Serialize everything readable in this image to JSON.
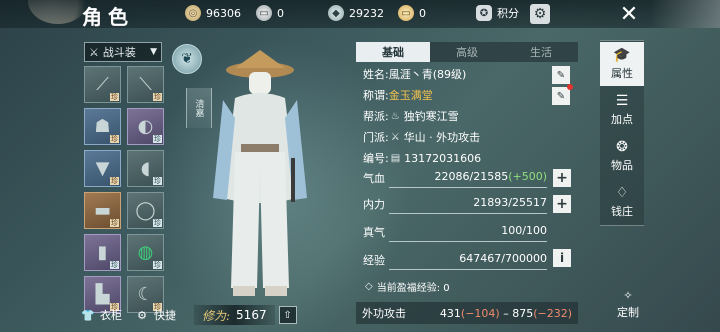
{
  "header": {
    "title": "角色",
    "currencies": [
      {
        "icon": "coin-icon",
        "value": "96306"
      },
      {
        "icon": "silver-ticket-icon",
        "value": "0"
      },
      {
        "icon": "ingot-icon",
        "value": "29232"
      },
      {
        "icon": "gold-ticket-icon",
        "value": "0"
      }
    ],
    "score_label": "积分",
    "colors": {
      "accent_gold": "#f2c14e",
      "bonus_green": "#8fe07d",
      "penalty_red": "#f08a6d"
    }
  },
  "equipment": {
    "set_name": "战斗装",
    "slots": [
      {
        "icon": "flute-icon",
        "tag": "珍"
      },
      {
        "icon": "staff-icon",
        "tag": "珍"
      },
      {
        "icon": "helmet-icon",
        "tag": "珍"
      },
      {
        "icon": "bracer-icon",
        "tag": "珍"
      },
      {
        "icon": "chest-armor-icon",
        "tag": "珍"
      },
      {
        "icon": "arm-guard-icon",
        "tag": "珍"
      },
      {
        "icon": "belt-icon",
        "tag": "珍"
      },
      {
        "icon": "ring-icon",
        "tag": "珍"
      },
      {
        "icon": "leg-guard-icon",
        "tag": "珍"
      },
      {
        "icon": "jade-bracelet-icon",
        "tag": "珍"
      },
      {
        "icon": "boots-icon",
        "tag": "珍"
      },
      {
        "icon": "hook-icon",
        "tag": "珍"
      }
    ],
    "style_badge": "清嘉"
  },
  "bottom": {
    "wardrobe_label": "衣柜",
    "shortcut_label": "快捷",
    "cultivation_label": "修为:",
    "cultivation_value": "5167"
  },
  "info_tabs": [
    "基础",
    "高级",
    "生活"
  ],
  "basic_info": {
    "name_label": "姓名:",
    "name_value": "風涯丶青(89级)",
    "title_label": "称谓:",
    "title_value": "金玉满堂",
    "guild_label": "帮派:",
    "guild_value": "独钓寒江雪",
    "sect_label": "门派:",
    "sect_value": "华山 · 外功攻击",
    "id_label": "编号:",
    "id_value": "13172031606"
  },
  "stats": {
    "hp_label": "气血",
    "hp_value": "22086/21585",
    "hp_bonus": "(+500)",
    "mp_label": "内力",
    "mp_value": "21893/25517",
    "true_qi_label": "真气",
    "true_qi_value": "100/100",
    "exp_label": "经验",
    "exp_value": "647467/700000",
    "surplus_exp_label": "当前盈福经验: 0",
    "attack_label": "外功攻击",
    "attack_low": "431",
    "attack_low_mod": "(−104)",
    "attack_sep": " – ",
    "attack_high": "875",
    "attack_high_mod": "(−232)"
  },
  "side_tabs": [
    {
      "label": "属性",
      "icon": "mortarboard-icon"
    },
    {
      "label": "加点",
      "icon": "sliders-icon"
    },
    {
      "label": "物品",
      "icon": "pouch-icon"
    },
    {
      "label": "钱庄",
      "icon": "money-bag-icon"
    }
  ],
  "custom_label": "定制"
}
